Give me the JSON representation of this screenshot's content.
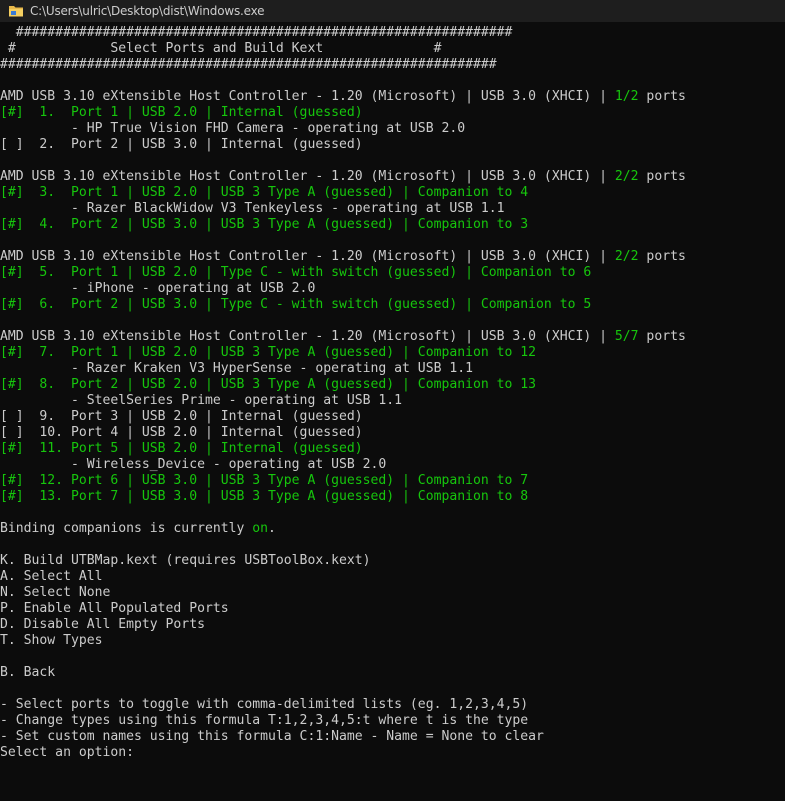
{
  "window": {
    "title": "C:\\Users\\ulric\\Desktop\\dist\\Windows.exe",
    "icon": "folder-icon"
  },
  "colors": {
    "background": "#0c0c0c",
    "text": "#cccccc",
    "green": "#16c60c"
  },
  "console": {
    "lines": [
      {
        "segs": [
          {
            "t": "  ###############################################################",
            "c": "w"
          }
        ]
      },
      {
        "segs": [
          {
            "t": " #            Select Ports and Build Kext              #",
            "c": "w"
          }
        ]
      },
      {
        "segs": [
          {
            "t": "###############################################################",
            "c": "w"
          }
        ]
      },
      {
        "segs": []
      },
      {
        "segs": [
          {
            "t": "AMD USB 3.10 eXtensible Host Controller - 1.20 (Microsoft) | USB 3.0 (XHCI) | ",
            "c": "w"
          },
          {
            "t": "1/2",
            "c": "g"
          },
          {
            "t": " ports",
            "c": "w"
          }
        ]
      },
      {
        "segs": [
          {
            "t": "[#]  1.  Port 1 | USB 2.0 | Internal (guessed)",
            "c": "g"
          }
        ]
      },
      {
        "segs": [
          {
            "t": "         - HP True Vision FHD Camera - operating at USB 2.0",
            "c": "w"
          }
        ]
      },
      {
        "segs": [
          {
            "t": "[ ]  2.  Port 2 | USB 3.0 | Internal (guessed)",
            "c": "w"
          }
        ]
      },
      {
        "segs": []
      },
      {
        "segs": [
          {
            "t": "AMD USB 3.10 eXtensible Host Controller - 1.20 (Microsoft) | USB 3.0 (XHCI) | ",
            "c": "w"
          },
          {
            "t": "2/2",
            "c": "g"
          },
          {
            "t": " ports",
            "c": "w"
          }
        ]
      },
      {
        "segs": [
          {
            "t": "[#]  3.  Port 1 | USB 2.0 | USB 3 Type A (guessed) | Companion to 4",
            "c": "g"
          }
        ]
      },
      {
        "segs": [
          {
            "t": "         - Razer BlackWidow V3 Tenkeyless - operating at USB 1.1",
            "c": "w"
          }
        ]
      },
      {
        "segs": [
          {
            "t": "[#]  4.  Port 2 | USB 3.0 | USB 3 Type A (guessed) | Companion to 3",
            "c": "g"
          }
        ]
      },
      {
        "segs": []
      },
      {
        "segs": [
          {
            "t": "AMD USB 3.10 eXtensible Host Controller - 1.20 (Microsoft) | USB 3.0 (XHCI) | ",
            "c": "w"
          },
          {
            "t": "2/2",
            "c": "g"
          },
          {
            "t": " ports",
            "c": "w"
          }
        ]
      },
      {
        "segs": [
          {
            "t": "[#]  5.  Port 1 | USB 2.0 | Type C - with switch (guessed) | Companion to 6",
            "c": "g"
          }
        ]
      },
      {
        "segs": [
          {
            "t": "         - iPhone - operating at USB 2.0",
            "c": "w"
          }
        ]
      },
      {
        "segs": [
          {
            "t": "[#]  6.  Port 2 | USB 3.0 | Type C - with switch (guessed) | Companion to 5",
            "c": "g"
          }
        ]
      },
      {
        "segs": []
      },
      {
        "segs": [
          {
            "t": "AMD USB 3.10 eXtensible Host Controller - 1.20 (Microsoft) | USB 3.0 (XHCI) | ",
            "c": "w"
          },
          {
            "t": "5/7",
            "c": "g"
          },
          {
            "t": " ports",
            "c": "w"
          }
        ]
      },
      {
        "segs": [
          {
            "t": "[#]  7.  Port 1 | USB 2.0 | USB 3 Type A (guessed) | Companion to 12",
            "c": "g"
          }
        ]
      },
      {
        "segs": [
          {
            "t": "         - Razer Kraken V3 HyperSense - operating at USB 1.1",
            "c": "w"
          }
        ]
      },
      {
        "segs": [
          {
            "t": "[#]  8.  Port 2 | USB 2.0 | USB 3 Type A (guessed) | Companion to 13",
            "c": "g"
          }
        ]
      },
      {
        "segs": [
          {
            "t": "         - SteelSeries Prime - operating at USB 1.1",
            "c": "w"
          }
        ]
      },
      {
        "segs": [
          {
            "t": "[ ]  9.  Port 3 | USB 2.0 | Internal (guessed)",
            "c": "w"
          }
        ]
      },
      {
        "segs": [
          {
            "t": "[ ]  10. Port 4 | USB 2.0 | Internal (guessed)",
            "c": "w"
          }
        ]
      },
      {
        "segs": [
          {
            "t": "[#]  11. Port 5 | USB 2.0 | Internal (guessed)",
            "c": "g"
          }
        ]
      },
      {
        "segs": [
          {
            "t": "         - Wireless_Device - operating at USB 2.0",
            "c": "w"
          }
        ]
      },
      {
        "segs": [
          {
            "t": "[#]  12. Port 6 | USB 3.0 | USB 3 Type A (guessed) | Companion to 7",
            "c": "g"
          }
        ]
      },
      {
        "segs": [
          {
            "t": "[#]  13. Port 7 | USB 3.0 | USB 3 Type A (guessed) | Companion to 8",
            "c": "g"
          }
        ]
      },
      {
        "segs": []
      },
      {
        "segs": [
          {
            "t": "Binding companions is currently ",
            "c": "w"
          },
          {
            "t": "on",
            "c": "g"
          },
          {
            "t": ".",
            "c": "w"
          }
        ]
      },
      {
        "segs": []
      },
      {
        "segs": [
          {
            "t": "K. Build UTBMap.kext (requires USBToolBox.kext)",
            "c": "w"
          }
        ]
      },
      {
        "segs": [
          {
            "t": "A. Select All",
            "c": "w"
          }
        ]
      },
      {
        "segs": [
          {
            "t": "N. Select None",
            "c": "w"
          }
        ]
      },
      {
        "segs": [
          {
            "t": "P. Enable All Populated Ports",
            "c": "w"
          }
        ]
      },
      {
        "segs": [
          {
            "t": "D. Disable All Empty Ports",
            "c": "w"
          }
        ]
      },
      {
        "segs": [
          {
            "t": "T. Show Types",
            "c": "w"
          }
        ]
      },
      {
        "segs": []
      },
      {
        "segs": [
          {
            "t": "B. Back",
            "c": "w"
          }
        ]
      },
      {
        "segs": []
      },
      {
        "segs": [
          {
            "t": "- Select ports to toggle with comma-delimited lists (eg. 1,2,3,4,5)",
            "c": "w"
          }
        ]
      },
      {
        "segs": [
          {
            "t": "- Change types using this formula T:1,2,3,4,5:t where t is the type",
            "c": "w"
          }
        ]
      },
      {
        "segs": [
          {
            "t": "- Set custom names using this formula C:1:Name - Name = None to clear",
            "c": "w"
          }
        ]
      },
      {
        "segs": [
          {
            "t": "Select an option: ",
            "c": "w"
          }
        ]
      }
    ]
  }
}
